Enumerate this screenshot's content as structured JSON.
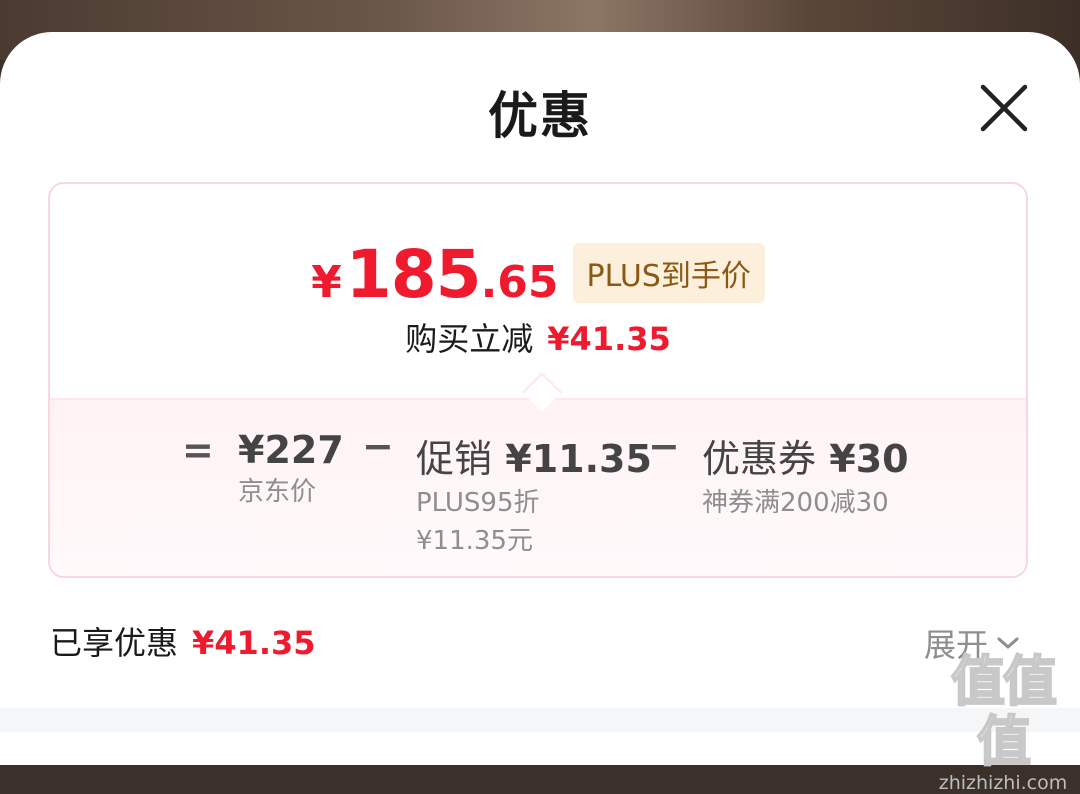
{
  "header": {
    "title": "优惠"
  },
  "price": {
    "currency": "¥",
    "integer": "185",
    "decimal": ".65",
    "tag": "PLUS到手价"
  },
  "reduction": {
    "label": "购买立减",
    "amount": "¥41.35"
  },
  "breakdown": {
    "equals": "=",
    "minus": "−",
    "base": {
      "main": "¥227",
      "sub": "京东价"
    },
    "promotion": {
      "label": "促销",
      "amount": "¥11.35",
      "sub1": "PLUS95折",
      "sub2": "¥11.35元"
    },
    "coupon": {
      "label": "优惠券",
      "amount": "¥30",
      "sub": "神券满200减30"
    }
  },
  "summary": {
    "label": "已享优惠",
    "amount": "¥41.35"
  },
  "expand": {
    "label": "展开"
  },
  "watermark": {
    "mark": "值值值",
    "site": "zhizhizhi.com"
  },
  "colors": {
    "accent": "#f01a2f",
    "tag_bg": "#fcefdc",
    "tag_text": "#8a5a14",
    "card_border": "#f9d7e2"
  },
  "icons": {
    "close": "close-icon",
    "expand": "chevron-down-icon"
  }
}
